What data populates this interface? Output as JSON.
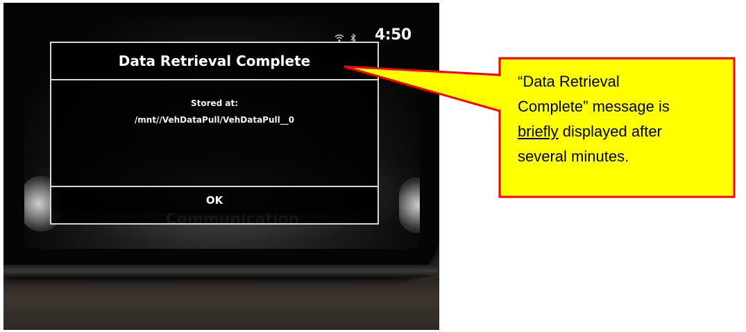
{
  "screen": {
    "status_bar": {
      "time": "4:50",
      "wifi_icon": "wifi-icon",
      "bluetooth_icon": "bluetooth-icon"
    },
    "dialog": {
      "title": "Data Retrieval Complete",
      "label": "Stored at:",
      "path": "/mnt//VehDataPull/VehDataPull__0",
      "ok_label": "OK"
    },
    "background_label": "Communication"
  },
  "callout": {
    "line1": "“Data Retrieval",
    "line2": "Complete” message is",
    "underlined_word": "briefly",
    "line3_rest": " displayed after",
    "line4": "several minutes.",
    "fill_color": "#ffff00",
    "border_color": "#ff0000"
  }
}
